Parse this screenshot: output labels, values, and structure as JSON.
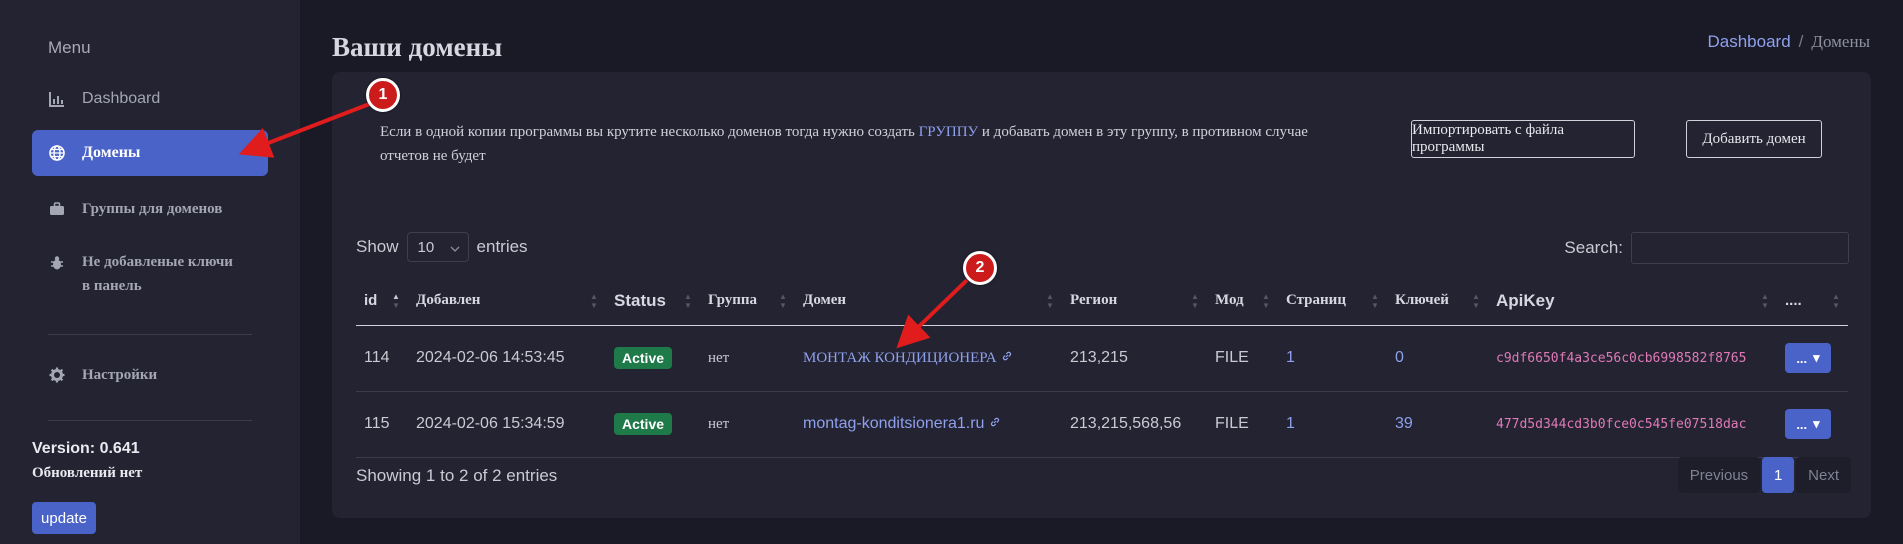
{
  "sidebar": {
    "heading": "Menu",
    "items": [
      {
        "label": "Dashboard",
        "icon": "chart-icon"
      },
      {
        "label": "Домены",
        "icon": "globe-icon"
      },
      {
        "label": "Группы для доменов",
        "icon": "briefcase-icon"
      },
      {
        "label": "Не добавленые ключи",
        "label2": "в панель",
        "icon": "bug-icon"
      },
      {
        "label": "Настройки",
        "icon": "gear-icon"
      }
    ],
    "version": "Version: 0.641",
    "updates": "Обновлений нет",
    "update_button": "update"
  },
  "header": {
    "title": "Ваши домены",
    "breadcrumb": {
      "link": "Dashboard",
      "sep": "/",
      "current": "Домены"
    }
  },
  "notice": {
    "part1": "Если в одной копии программы вы крутите несколько доменов тогда нужно создать ",
    "link": "ГРУППУ",
    "part2": " и добавать домен в эту группу, в противном случае отчетов не будет"
  },
  "buttons": {
    "import": "Импортировать с файла программы",
    "add": "Добавить домен"
  },
  "table_controls": {
    "show": "Show",
    "page_size": "10",
    "entries": "entries",
    "search": "Search:"
  },
  "table": {
    "columns": [
      "id",
      "Добавлен",
      "Status",
      "Группа",
      "Домен",
      "Регион",
      "Мод",
      "Страниц",
      "Ключей",
      "ApiKey",
      "...."
    ],
    "rows": [
      {
        "id": "114",
        "added": "2024-02-06 14:53:45",
        "status": "Active",
        "group": "нет",
        "domain": "МОНТАЖ КОНДИЦИОНЕРА",
        "region": "213,215",
        "mode": "FILE",
        "pages": "1",
        "keys": "0",
        "apikey": "c9df6650f4a3ce56c0cb6998582f8765"
      },
      {
        "id": "115",
        "added": "2024-02-06 15:34:59",
        "status": "Active",
        "group": "нет",
        "domain": "montag-konditsionera1.ru",
        "region": "213,215,568,56",
        "mode": "FILE",
        "pages": "1",
        "keys": "39",
        "apikey": "477d5d344cd3b0fce0c545fe07518dac"
      }
    ],
    "row_action": "..."
  },
  "footer": {
    "info": "Showing 1 to 2 of 2 entries",
    "prev": "Previous",
    "page": "1",
    "next": "Next"
  },
  "annotations": {
    "first": "1",
    "second": "2"
  },
  "colors": {
    "accent": "#4a63c8",
    "active_badge": "#1f7a4a",
    "annotation": "#cc1b1b",
    "apikey": "#e07ab6"
  }
}
